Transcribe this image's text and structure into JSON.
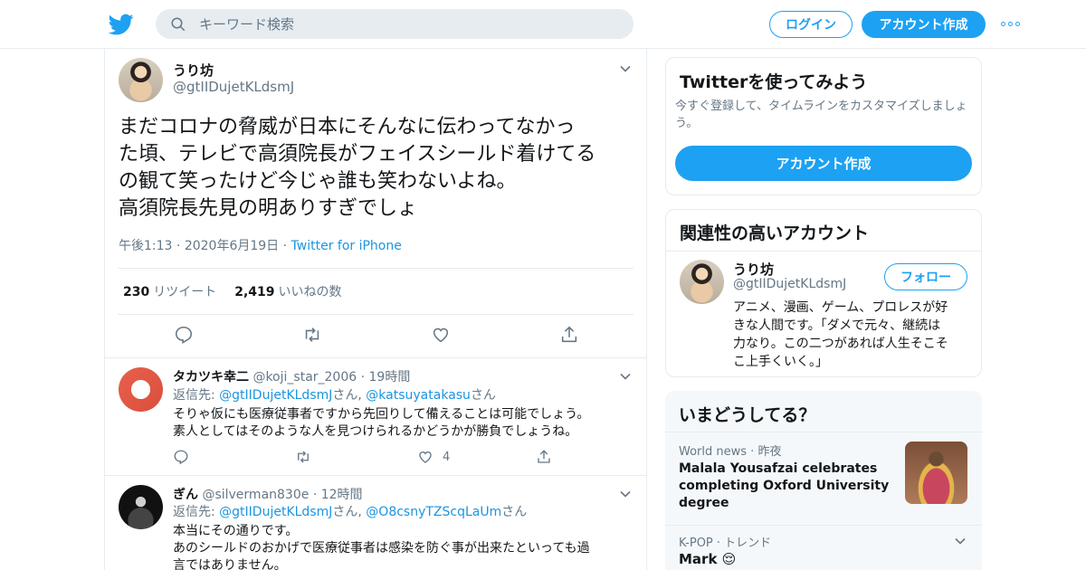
{
  "header": {
    "search_placeholder": "キーワード検索",
    "login_label": "ログイン",
    "signup_label": "アカウント作成"
  },
  "tweet": {
    "name": "うり坊",
    "handle": "@gtIIDujetKLdsmJ",
    "text_lines": [
      "まだコロナの脅威が日本にそんなに伝わってなかっ",
      "た頃、テレビで高須院長がフェイスシールド着けてる",
      "の観て笑ったけど今じゃ誰も笑わないよね。",
      "高須院長先見の明ありすぎでしょ"
    ],
    "time": "午後1:13",
    "date": "2020年6月19日",
    "source": "Twitter for iPhone",
    "retweets": "230",
    "retweets_label": "リツイート",
    "likes": "2,419",
    "likes_label": "いいねの数"
  },
  "replies": [
    {
      "name": "タカツキ幸二",
      "handle": "@koji_star_2006",
      "time": "19時間",
      "reply_prefix": "返信先: ",
      "reply_to_1": "@gtIIDujetKLdsmJ",
      "reply_suffix_1": "さん, ",
      "reply_to_2": "@katsuyatakasu",
      "reply_suffix_2": "さん",
      "text_lines": [
        "そりゃ仮にも医療従事者ですから先回りして備えることは可能でしょう。",
        "素人としてはそのような人を見つけられるかどうかが勝負でしょうね。"
      ],
      "likes": "4"
    },
    {
      "name": "ぎん",
      "handle": "@silverman830e",
      "time": "12時間",
      "reply_prefix": "返信先: ",
      "reply_to_1": "@gtIIDujetKLdsmJ",
      "reply_suffix_1": "さん, ",
      "reply_to_2": "@O8csnyTZScqLaUm",
      "reply_suffix_2": "さん",
      "text_lines": [
        "本当にその通りです。",
        "あのシールドのおかげで医療従事者は感染を防ぐ事が出来たといっても過",
        "言ではありません。"
      ]
    }
  ],
  "try_twitter": {
    "title": "Twitterを使ってみよう",
    "desc": "今すぐ登録して、タイムラインをカスタマイズしましょう。",
    "button": "アカウント作成"
  },
  "related": {
    "title": "関連性の高いアカウント",
    "name": "うり坊",
    "handle": "@gtIIDujetKLdsmJ",
    "follow_label": "フォロー",
    "bio_lines": [
      "アニメ、漫画、ゲーム、プロレスが好",
      "きな人間です。「ダメで元々、継続は",
      "力なり。この二つがあれば人生そこそ",
      "こ上手くいく。」"
    ]
  },
  "trends": {
    "title": "いまどうしてる？",
    "items": [
      {
        "context": "World news",
        "time": "昨夜",
        "headline_lines": [
          "Malala Yousafzai celebrates",
          "completing Oxford University",
          "degree"
        ]
      },
      {
        "context": "K-POP",
        "category": "トレンド",
        "label": "Mark",
        "emoji": "😌"
      }
    ]
  },
  "colors": {
    "accent": "#1da1f2",
    "link": "#1b95e0",
    "muted": "#657786",
    "border": "#e6ecf0"
  }
}
